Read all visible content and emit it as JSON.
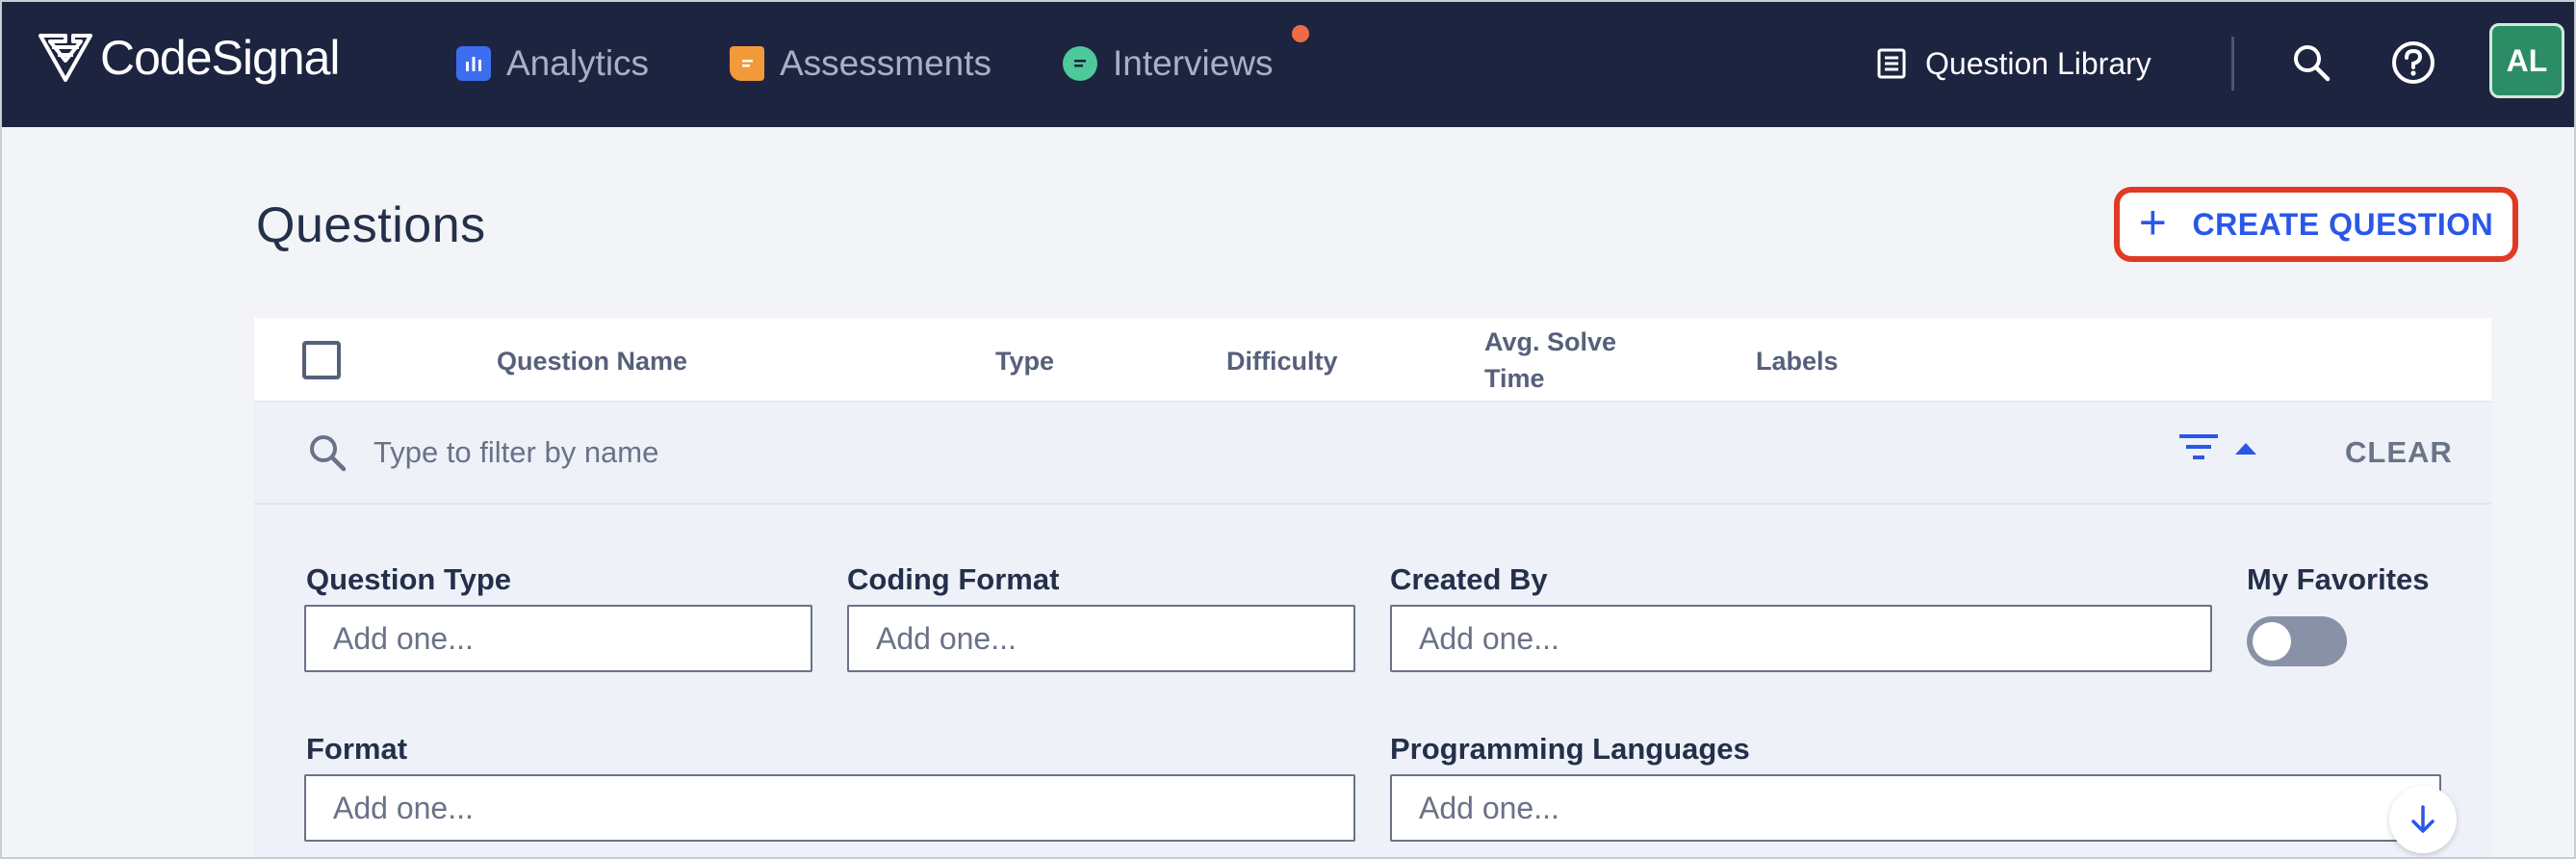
{
  "nav": {
    "brand": "CodeSignal",
    "items": [
      {
        "label": "Analytics",
        "icon": "analytics-icon",
        "color": "#3d6ef0"
      },
      {
        "label": "Assessments",
        "icon": "assessments-icon",
        "color": "#f29a3a"
      },
      {
        "label": "Interviews",
        "icon": "interviews-icon",
        "color": "#4ec99a"
      }
    ],
    "question_library": "Question Library",
    "avatar": "AL"
  },
  "page": {
    "title": "Questions",
    "create_button": "CREATE QUESTION"
  },
  "table": {
    "columns": [
      "Question Name",
      "Type",
      "Difficulty",
      "Avg. Solve",
      "Time",
      "Labels"
    ]
  },
  "filter": {
    "placeholder": "Type to filter by name",
    "clear": "CLEAR",
    "fields": {
      "question_type": {
        "label": "Question Type",
        "placeholder": "Add one..."
      },
      "coding_format": {
        "label": "Coding Format",
        "placeholder": "Add one..."
      },
      "created_by": {
        "label": "Created By",
        "placeholder": "Add one..."
      },
      "my_favorites": {
        "label": "My Favorites"
      },
      "format": {
        "label": "Format",
        "placeholder": "Add one..."
      },
      "programming_languages": {
        "label": "Programming Languages",
        "placeholder": "Add one..."
      }
    }
  },
  "colors": {
    "nav_bg": "#1d2440",
    "accent": "#2a57e8",
    "highlight": "#e03a24",
    "avatar_bg": "#2c8c66",
    "notification": "#ef6a47"
  }
}
